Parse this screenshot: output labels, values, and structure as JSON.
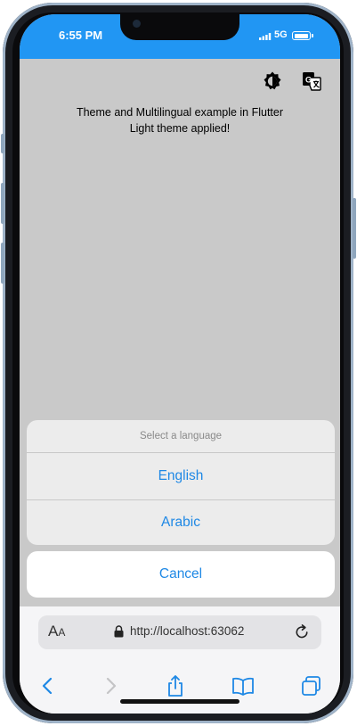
{
  "status_bar": {
    "time": "6:55 PM",
    "network": "5G",
    "color": "#2196f3"
  },
  "app": {
    "actions": [
      {
        "icon": "brightness-icon"
      },
      {
        "icon": "translate-icon"
      }
    ],
    "title_line": "Theme and Multilingual example in Flutter",
    "subtitle_line": "Light theme applied!",
    "background": "#c9c9c9"
  },
  "language_sheet": {
    "title": "Select a language",
    "options": [
      {
        "label": "English"
      },
      {
        "label": "Arabic"
      }
    ],
    "cancel_label": "Cancel",
    "accent": "#1e88e5"
  },
  "browser": {
    "text_size_label_large": "A",
    "text_size_label_small": "A",
    "url": "http://localhost:63062",
    "toolbar": [
      "back-icon",
      "forward-icon",
      "share-icon",
      "bookmarks-icon",
      "tabs-icon"
    ]
  }
}
